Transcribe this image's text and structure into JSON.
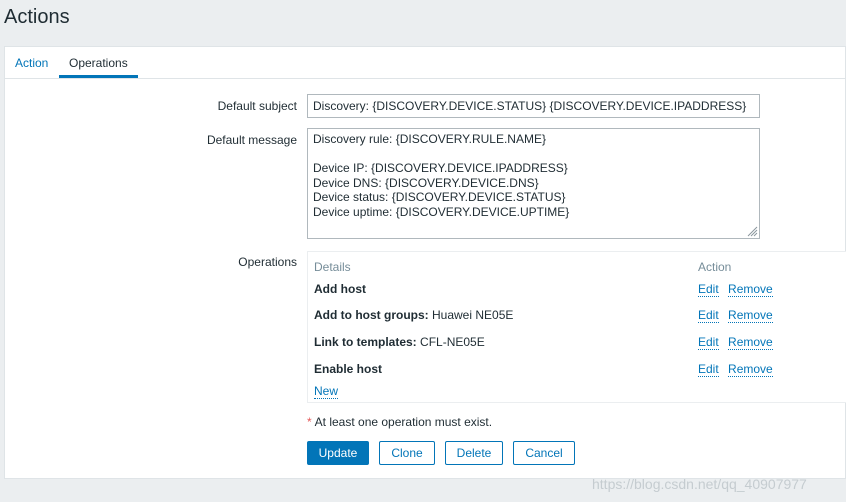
{
  "page": {
    "title": "Actions"
  },
  "tabs": [
    {
      "label": "Action",
      "active": false
    },
    {
      "label": "Operations",
      "active": true
    }
  ],
  "form": {
    "default_subject_label": "Default subject",
    "default_subject_value": "Discovery: {DISCOVERY.DEVICE.STATUS} {DISCOVERY.DEVICE.IPADDRESS}",
    "default_message_label": "Default message",
    "default_message_lines": [
      "Discovery rule: {DISCOVERY.RULE.NAME}",
      "",
      "Device IP: {DISCOVERY.DEVICE.IPADDRESS}",
      "Device DNS: {DISCOVERY.DEVICE.DNS}",
      "Device status: {DISCOVERY.DEVICE.STATUS}",
      "Device uptime: {DISCOVERY.DEVICE.UPTIME}"
    ],
    "operations_label": "Operations"
  },
  "operations": {
    "header_details": "Details",
    "header_action": "Action",
    "rows": [
      {
        "label": "Add host",
        "value": "",
        "edit": "Edit",
        "remove": "Remove"
      },
      {
        "label": "Add to host groups:",
        "value": "Huawei NE05E",
        "edit": "Edit",
        "remove": "Remove"
      },
      {
        "label": "Link to templates:",
        "value": "CFL-NE05E",
        "edit": "Edit",
        "remove": "Remove"
      },
      {
        "label": "Enable host",
        "value": "",
        "edit": "Edit",
        "remove": "Remove"
      }
    ],
    "new_link": "New"
  },
  "note": {
    "star": "*",
    "text": "At least one operation must exist."
  },
  "buttons": {
    "update": "Update",
    "clone": "Clone",
    "delete": "Delete",
    "cancel": "Cancel"
  },
  "watermark": "https://blog.csdn.net/qq_40907977",
  "colors": {
    "accent": "#0275b8",
    "required": "#e45959",
    "muted": "#768d99"
  }
}
